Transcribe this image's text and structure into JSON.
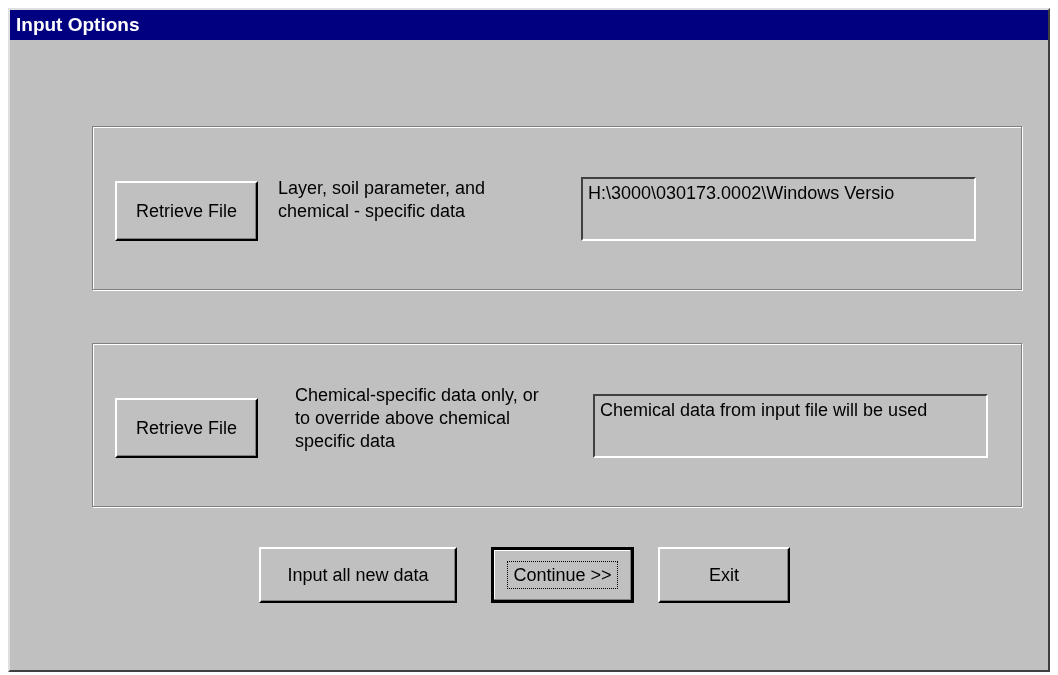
{
  "window": {
    "title": "Input Options"
  },
  "groups": [
    {
      "button": "Retrieve File",
      "description": "Layer, soil parameter, and chemical - specific data",
      "field_value": "H:\\3000\\030173.0002\\Windows Versio"
    },
    {
      "button": "Retrieve File",
      "description": "Chemical-specific data only, or to override above chemical specific data",
      "field_value": "Chemical data from input file will be used"
    }
  ],
  "buttons": [
    {
      "label": "Input all new data",
      "focused": false
    },
    {
      "label": "Continue >>",
      "focused": true
    },
    {
      "label": "Exit",
      "focused": false
    }
  ]
}
